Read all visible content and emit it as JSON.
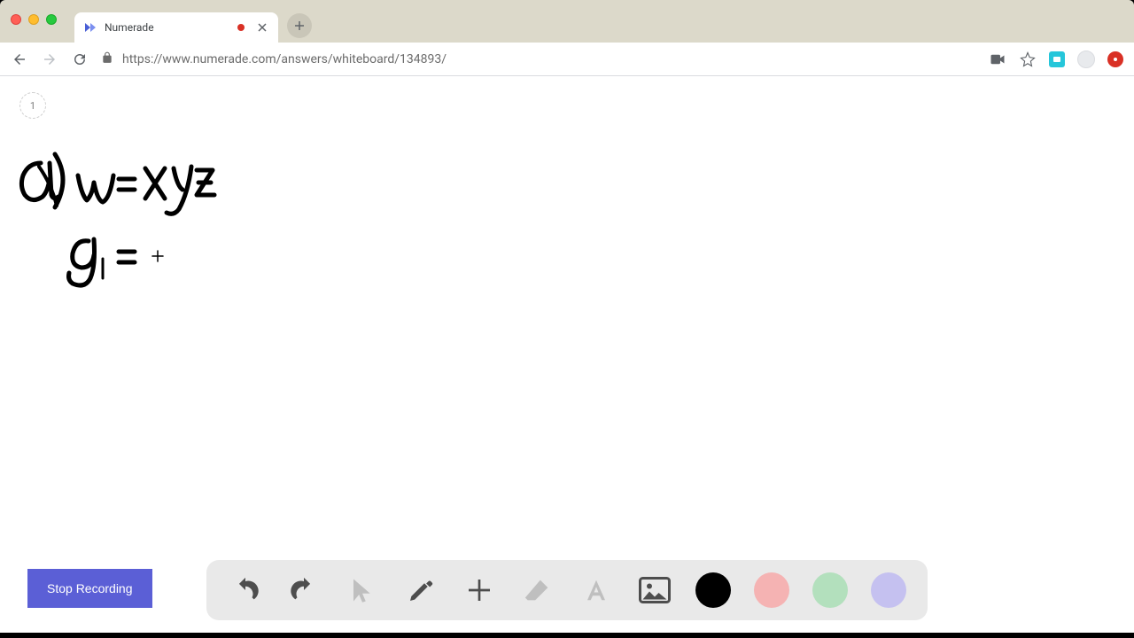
{
  "browser": {
    "tab_title": "Numerade",
    "url": "https://www.numerade.com/answers/whiteboard/134893/"
  },
  "page": {
    "badge_number": "1",
    "stop_button_label": "Stop Recording"
  },
  "whiteboard": {
    "line1": "a) w = xyz",
    "line2": "g₁ =  +"
  },
  "toolbar": {
    "tools": {
      "undo": "undo",
      "redo": "redo",
      "pointer": "pointer",
      "pen": "pen",
      "plus": "plus",
      "eraser": "eraser",
      "text": "text",
      "image": "image"
    },
    "colors": {
      "black": "#000000",
      "pink": "#f5b3b3",
      "green": "#b3e0bd",
      "purple": "#c5c1f0"
    }
  }
}
